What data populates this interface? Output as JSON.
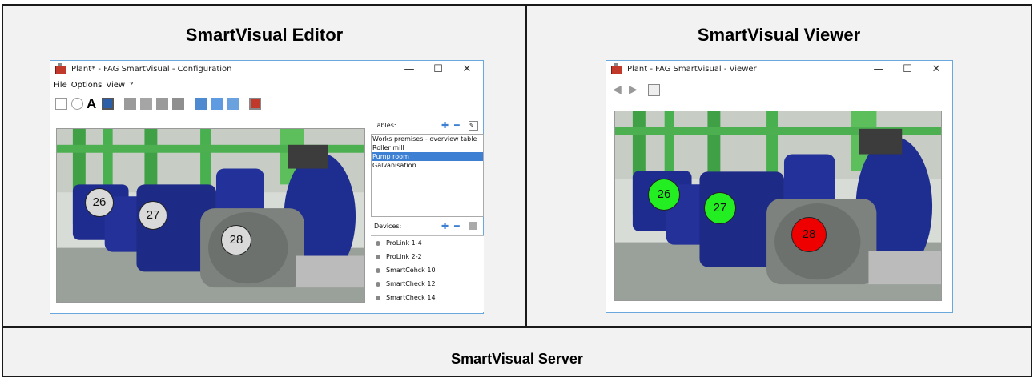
{
  "panels": {
    "editor_title": "SmartVisual Editor",
    "viewer_title": "SmartVisual Viewer",
    "server_title": "SmartVisual Server"
  },
  "editor": {
    "window_title": "Plant* - FAG SmartVisual - Configuration",
    "controls": {
      "minimize": "—",
      "maximize": "☐",
      "close": "✕"
    },
    "menu": [
      "File",
      "Options",
      "View",
      "?"
    ],
    "markers": [
      {
        "label": "26",
        "color": "#d9d9d9"
      },
      {
        "label": "27",
        "color": "#d9d9d9"
      },
      {
        "label": "28",
        "color": "#d9d9d9"
      }
    ],
    "tables": {
      "label": "Tables:",
      "items": [
        "Works premises - overview table",
        "Roller mill",
        "Pump room",
        "Galvanisation"
      ],
      "selected_index": 2
    },
    "devices": {
      "label": "Devices:",
      "items": [
        "ProLink 1-4",
        "ProLink 2-2",
        "SmartCehck 10",
        "SmartCheck 12",
        "SmartCheck 14"
      ]
    }
  },
  "viewer": {
    "window_title": "Plant - FAG SmartVisual - Viewer",
    "controls": {
      "minimize": "—",
      "maximize": "☐",
      "close": "✕"
    },
    "markers": [
      {
        "label": "26",
        "color": "#22ee22"
      },
      {
        "label": "27",
        "color": "#22ee22"
      },
      {
        "label": "28",
        "color": "#ee0000"
      }
    ]
  }
}
